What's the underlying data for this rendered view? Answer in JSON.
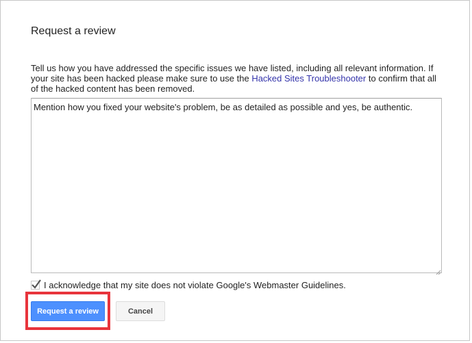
{
  "dialog": {
    "title": "Request a review",
    "description_before": "Tell us how you have addressed the specific issues we have listed, including all relevant information. If your site has been hacked please make sure to use the ",
    "description_link": "Hacked Sites Troubleshooter",
    "description_after": " to confirm that all of the hacked content has been removed.",
    "textarea_value": "Mention how you fixed your website's problem, be as detailed as possible and yes, be authentic.",
    "acknowledge_label": "I acknowledge that my site does not violate Google's Webmaster Guidelines.",
    "acknowledge_checked": true,
    "submit_label": "Request a review",
    "cancel_label": "Cancel"
  },
  "colors": {
    "primary_button": "#4d90fe",
    "link": "#3333aa",
    "highlight": "#e8343c"
  },
  "icons": {
    "checkbox": "checkmark-icon",
    "resize": "resize-grip-icon"
  }
}
